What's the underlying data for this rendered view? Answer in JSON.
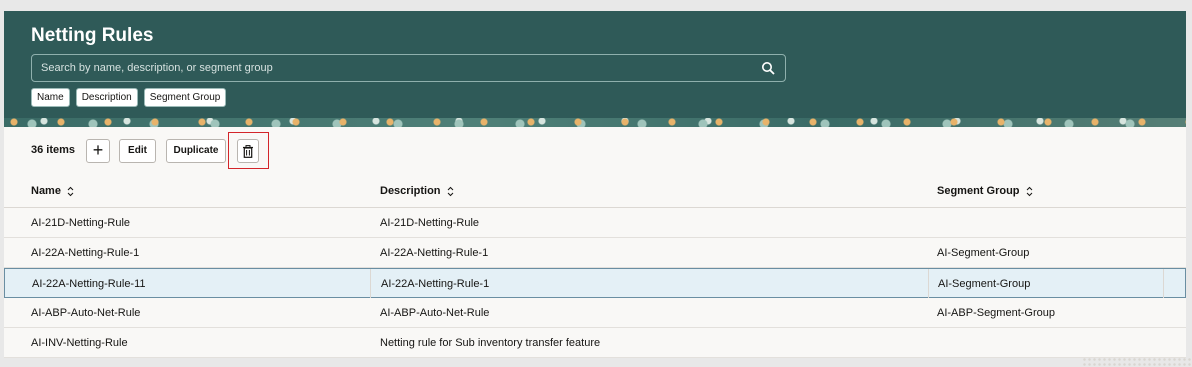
{
  "page": {
    "title": "Netting Rules"
  },
  "search": {
    "placeholder": "Search by name, description, or segment group",
    "value": ""
  },
  "chips": [
    "Name",
    "Description",
    "Segment Group"
  ],
  "toolbar": {
    "count": "36 items",
    "add_label": "+",
    "edit_label": "Edit",
    "duplicate_label": "Duplicate"
  },
  "table": {
    "headers": {
      "name": "Name",
      "description": "Description",
      "segment_group": "Segment Group"
    },
    "rows": [
      {
        "name": "AI-21D-Netting-Rule",
        "description": "AI-21D-Netting-Rule",
        "segment_group": ""
      },
      {
        "name": "AI-22A-Netting-Rule-1",
        "description": "AI-22A-Netting-Rule-1",
        "segment_group": "AI-Segment-Group"
      },
      {
        "name": "AI-22A-Netting-Rule-11",
        "description": "AI-22A-Netting-Rule-1",
        "segment_group": "AI-Segment-Group",
        "selected": true
      },
      {
        "name": "AI-ABP-Auto-Net-Rule",
        "description": "AI-ABP-Auto-Net-Rule",
        "segment_group": "AI-ABP-Segment-Group"
      },
      {
        "name": "AI-INV-Netting-Rule",
        "description": "Netting rule for Sub inventory transfer feature",
        "segment_group": ""
      }
    ]
  },
  "colors": {
    "header_bg": "#2f5a58",
    "selected_row": "#e4f0f6",
    "highlight_box": "#d3252a"
  },
  "icons": [
    "search-icon",
    "plus-icon",
    "trash-icon",
    "sort-icon"
  ]
}
